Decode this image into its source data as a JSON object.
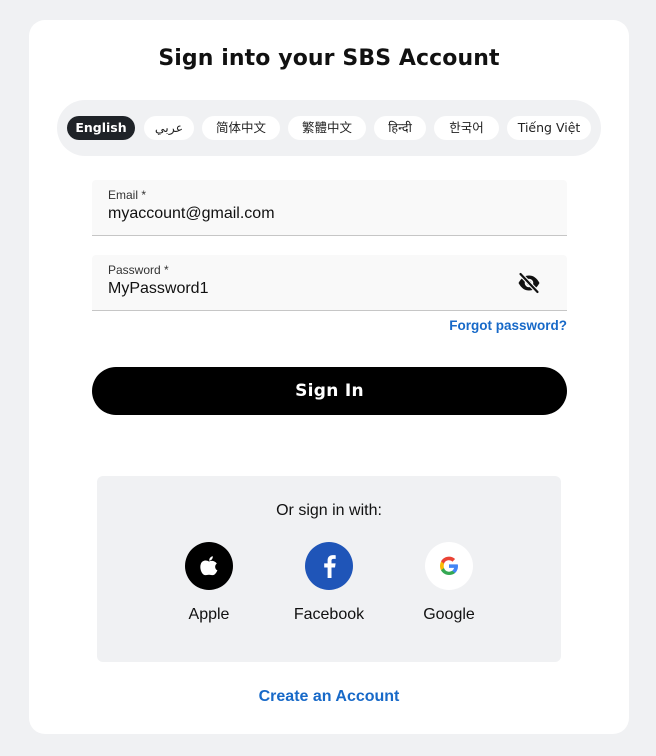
{
  "title": "Sign into your SBS Account",
  "languages": [
    {
      "label": "English",
      "active": true
    },
    {
      "label": "عربي",
      "active": false
    },
    {
      "label": "简体中文",
      "active": false
    },
    {
      "label": "繁體中文",
      "active": false
    },
    {
      "label": "हिन्दी",
      "active": false
    },
    {
      "label": "한국어",
      "active": false
    },
    {
      "label": "Tiếng Việt",
      "active": false
    }
  ],
  "email": {
    "label": "Email *",
    "value": "myaccount@gmail.com"
  },
  "password": {
    "label": "Password *",
    "value": "MyPassword1",
    "toggle_icon": "eye-off-icon"
  },
  "forgot_password": "Forgot password?",
  "sign_in_label": "Sign In",
  "social": {
    "heading": "Or sign in with:",
    "providers": [
      {
        "label": "Apple",
        "icon": "apple-icon",
        "color": "#000000"
      },
      {
        "label": "Facebook",
        "icon": "facebook-icon",
        "color": "#1f55b8"
      },
      {
        "label": "Google",
        "icon": "google-icon",
        "color": "#ffffff"
      }
    ]
  },
  "create_account": "Create an Account",
  "colors": {
    "background": "#f0f1f3",
    "link": "#1769c8",
    "primary_button": "#000000",
    "active_language": "#1f2328"
  }
}
